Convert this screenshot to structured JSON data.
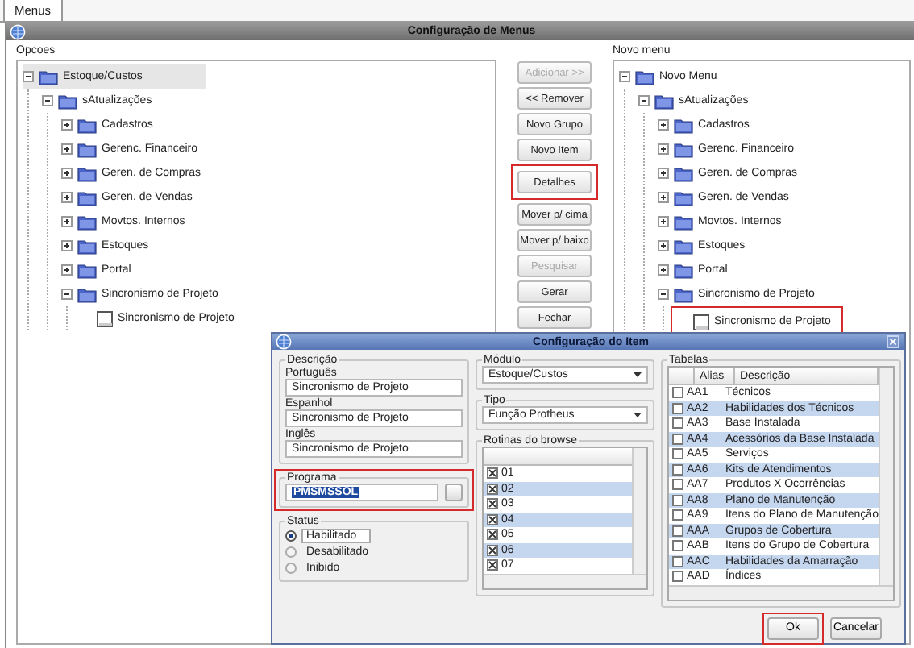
{
  "tabs": [
    {
      "label": "Menus",
      "selected": true
    }
  ],
  "window": {
    "title": "Configuração de Menus"
  },
  "options_panel": {
    "label": "Opcoes",
    "tree": [
      {
        "label": "Estoque/Custos",
        "kind": "folder",
        "expanded": true,
        "selected": true,
        "children": [
          {
            "label": "sAtualizações",
            "kind": "folder",
            "expanded": true,
            "selected": false,
            "children": [
              {
                "label": "Cadastros",
                "kind": "folder",
                "expanded": false,
                "selected": false
              },
              {
                "label": "Gerenc. Financeiro",
                "kind": "folder",
                "expanded": false,
                "selected": false
              },
              {
                "label": "Geren. de Compras",
                "kind": "folder",
                "expanded": false,
                "selected": false
              },
              {
                "label": "Geren. de Vendas",
                "kind": "folder",
                "expanded": false,
                "selected": false
              },
              {
                "label": "Movtos. Internos",
                "kind": "folder",
                "expanded": false,
                "selected": false
              },
              {
                "label": "Estoques",
                "kind": "folder",
                "expanded": false,
                "selected": false
              },
              {
                "label": "Portal",
                "kind": "folder",
                "expanded": false,
                "selected": false
              },
              {
                "label": "Sincronismo de Projeto",
                "kind": "folder",
                "expanded": true,
                "selected": false,
                "children": [
                  {
                    "label": "Sincronismo de Projeto",
                    "kind": "item",
                    "selected": false
                  }
                ]
              }
            ]
          }
        ]
      }
    ]
  },
  "buttons": [
    {
      "label": "Adicionar >>",
      "disabled": true,
      "highlighted": false
    },
    {
      "label": "<< Remover",
      "disabled": false,
      "highlighted": false
    },
    {
      "label": "Novo Grupo",
      "disabled": false,
      "highlighted": false
    },
    {
      "label": "Novo Item",
      "disabled": false,
      "highlighted": false
    },
    {
      "label": "Detalhes",
      "disabled": false,
      "highlighted": true
    },
    {
      "label": "Mover p/ cima",
      "disabled": false,
      "highlighted": false
    },
    {
      "label": "Mover p/ baixo",
      "disabled": false,
      "highlighted": false
    },
    {
      "label": "Pesquisar",
      "disabled": true,
      "highlighted": false
    },
    {
      "label": "Gerar",
      "disabled": false,
      "highlighted": false
    },
    {
      "label": "Fechar",
      "disabled": false,
      "highlighted": false
    }
  ],
  "new_menu_panel": {
    "label": "Novo menu",
    "tree": [
      {
        "label": "Novo Menu",
        "kind": "folder",
        "expanded": true,
        "selected": false,
        "children": [
          {
            "label": "sAtualizações",
            "kind": "folder",
            "expanded": true,
            "selected": false,
            "children": [
              {
                "label": "Cadastros",
                "kind": "folder",
                "expanded": false,
                "selected": false
              },
              {
                "label": "Gerenc. Financeiro",
                "kind": "folder",
                "expanded": false,
                "selected": false
              },
              {
                "label": "Geren. de Compras",
                "kind": "folder",
                "expanded": false,
                "selected": false
              },
              {
                "label": "Geren. de Vendas",
                "kind": "folder",
                "expanded": false,
                "selected": false
              },
              {
                "label": "Movtos. Internos",
                "kind": "folder",
                "expanded": false,
                "selected": false
              },
              {
                "label": "Estoques",
                "kind": "folder",
                "expanded": false,
                "selected": false
              },
              {
                "label": "Portal",
                "kind": "folder",
                "expanded": false,
                "selected": false
              },
              {
                "label": "Sincronismo de Projeto",
                "kind": "folder",
                "expanded": true,
                "selected": false,
                "children": [
                  {
                    "label": "Sincronismo de Projeto",
                    "kind": "item",
                    "selected": false,
                    "highlighted": true
                  }
                ]
              }
            ]
          }
        ]
      }
    ]
  },
  "dialog": {
    "title": "Configuração do Item",
    "description": {
      "label": "Descrição",
      "fields": [
        {
          "label": "Português",
          "value": "Sincronismo de Projeto"
        },
        {
          "label": "Espanhol",
          "value": "Sincronismo de Projeto"
        },
        {
          "label": "Inglês",
          "value": "Sincronismo de Projeto"
        }
      ]
    },
    "program": {
      "label": "Programa",
      "value": "PMSMSSOL",
      "highlighted": true
    },
    "status": {
      "label": "Status",
      "options": [
        {
          "label": "Habilitado",
          "selected": true
        },
        {
          "label": "Desabilitado",
          "selected": false
        },
        {
          "label": "Inibido",
          "selected": false
        }
      ]
    },
    "module": {
      "label": "Módulo",
      "value": "Estoque/Custos"
    },
    "type": {
      "label": "Tipo",
      "value": "Função Protheus"
    },
    "browse_routines": {
      "label": "Rotinas do browse",
      "rows": [
        {
          "code": "01",
          "checked": true
        },
        {
          "code": "02",
          "checked": true
        },
        {
          "code": "03",
          "checked": true
        },
        {
          "code": "04",
          "checked": true
        },
        {
          "code": "05",
          "checked": true
        },
        {
          "code": "06",
          "checked": true
        },
        {
          "code": "07",
          "checked": true
        }
      ]
    },
    "tables": {
      "label": "Tabelas",
      "columns": [
        "Alias",
        "Descrição"
      ],
      "rows": [
        {
          "alias": "AA1",
          "description": "Técnicos",
          "checked": false
        },
        {
          "alias": "AA2",
          "description": "Habilidades dos Técnicos",
          "checked": false
        },
        {
          "alias": "AA3",
          "description": "Base Instalada",
          "checked": false
        },
        {
          "alias": "AA4",
          "description": "Acessórios da Base Instalada",
          "checked": false
        },
        {
          "alias": "AA5",
          "description": "Serviços",
          "checked": false
        },
        {
          "alias": "AA6",
          "description": "Kits de Atendimentos",
          "checked": false
        },
        {
          "alias": "AA7",
          "description": "Produtos X Ocorrências",
          "checked": false
        },
        {
          "alias": "AA8",
          "description": "Plano de Manutenção",
          "checked": false
        },
        {
          "alias": "AA9",
          "description": "Itens do Plano de Manutenção",
          "checked": false
        },
        {
          "alias": "AAA",
          "description": "Grupos de Cobertura",
          "checked": false
        },
        {
          "alias": "AAB",
          "description": "Itens do Grupo de Cobertura",
          "checked": false
        },
        {
          "alias": "AAC",
          "description": "Habilidades da Amarração",
          "checked": false
        },
        {
          "alias": "AAD",
          "description": "Índices",
          "checked": false
        }
      ]
    },
    "buttons": [
      {
        "label": "Ok",
        "highlighted": true
      },
      {
        "label": "Cancelar",
        "highlighted": false
      }
    ]
  }
}
